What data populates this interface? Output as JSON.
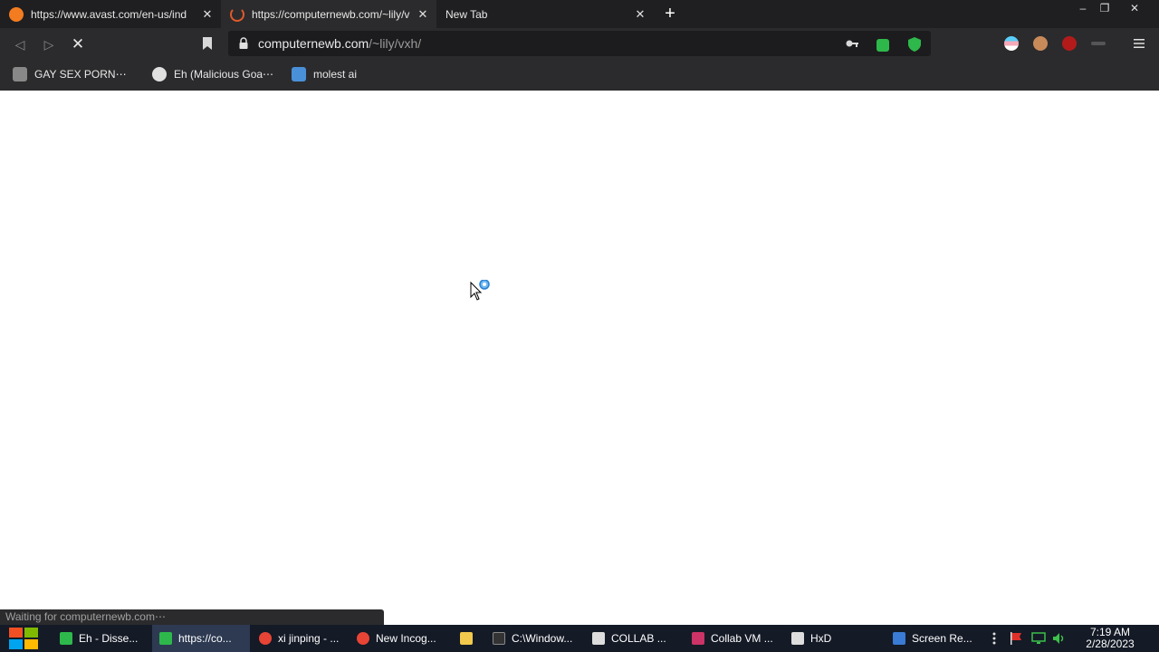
{
  "tabs": [
    {
      "title": "https://www.avast.com/en-us/ind",
      "close": "✕",
      "favicon_color": "#f47c20"
    },
    {
      "title": "https://computernewb.com/~lily/v",
      "close": "✕",
      "favicon_color": "#e05a2a"
    },
    {
      "title": "New Tab",
      "close": "✕"
    }
  ],
  "new_tab_label": "+",
  "window_controls": {
    "minimize": "–",
    "restore": "❐",
    "close": "✕"
  },
  "toolbar": {
    "back": "◁",
    "forward": "▷",
    "stop": "✕"
  },
  "address_bar": {
    "host": "computernewb.com",
    "path": "/~lily/vxh/"
  },
  "bookmarks": [
    {
      "label": "GAY SEX PORN⋯",
      "icon": "horse-icon"
    },
    {
      "label": "Eh (Malicious Goa⋯",
      "icon": "globe-icon"
    },
    {
      "label": "molest ai",
      "icon": "image-icon"
    }
  ],
  "status_text": "Waiting for computernewb.com⋯",
  "taskbar": {
    "items": [
      {
        "label": "Eh - Disse...",
        "color": "#2eb84b"
      },
      {
        "label": "https://co...",
        "color": "#2eb84b"
      },
      {
        "label": "xi jinping - ...",
        "color": "#e84436"
      },
      {
        "label": "New Incog...",
        "color": "#e84436"
      },
      {
        "label": "",
        "color": "#f2c94c"
      },
      {
        "label": "C:\\Window...",
        "color": "#333333"
      },
      {
        "label": "COLLAB ...",
        "color": "#dddddd"
      },
      {
        "label": "Collab VM ...",
        "color": "#cc3366"
      },
      {
        "label": "HxD",
        "color": "#dddddd"
      },
      {
        "label": "Screen Re...",
        "color": "#3a7bd5"
      }
    ],
    "clock_time": "7:19 AM",
    "clock_date": "2/28/2023"
  },
  "colors": {
    "accent_green": "#2eb84b",
    "ublock_red": "#b31b1b"
  }
}
